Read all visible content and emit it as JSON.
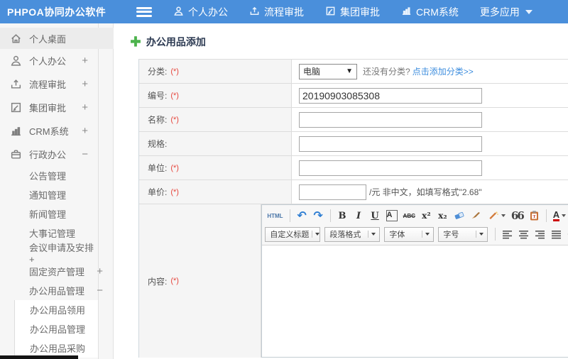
{
  "topbar": {
    "logo": "PHPOA协同办公软件",
    "nav": [
      {
        "label": "个人办公",
        "icon": "user-icon"
      },
      {
        "label": "流程审批",
        "icon": "workflow-icon"
      },
      {
        "label": "集团审批",
        "icon": "edit-square-icon"
      },
      {
        "label": "CRM系统",
        "icon": "bar-chart-icon"
      },
      {
        "label": "更多应用",
        "icon": "caret-down-icon"
      }
    ]
  },
  "sidebar": {
    "items": [
      {
        "label": "个人桌面",
        "expand": ""
      },
      {
        "label": "个人办公",
        "expand": "+"
      },
      {
        "label": "流程审批",
        "expand": "+"
      },
      {
        "label": "集团审批",
        "expand": "+"
      },
      {
        "label": "CRM系统",
        "expand": "+"
      },
      {
        "label": "行政办公",
        "expand": "−"
      },
      {
        "label": "公告管理"
      },
      {
        "label": "通知管理"
      },
      {
        "label": "新闻管理"
      },
      {
        "label": "大事记管理"
      },
      {
        "label": "会议申请及安排+"
      },
      {
        "label": "固定资产管理",
        "expand": "+"
      },
      {
        "label": "办公用品管理",
        "expand": "−"
      },
      {
        "label": "办公用品领用"
      },
      {
        "label": "办公用品管理"
      },
      {
        "label": "办公用品采购"
      }
    ]
  },
  "main": {
    "title": "办公用品添加",
    "form": {
      "star": "(*)",
      "category": {
        "label": "分类:",
        "select_value": "电脑",
        "hint": "还没有分类?",
        "link": "点击添加分类>>"
      },
      "code": {
        "label": "编号:",
        "value": "20190903085308"
      },
      "name": {
        "label": "名称:"
      },
      "spec": {
        "label": "规格:"
      },
      "unit": {
        "label": "单位:"
      },
      "price": {
        "label": "单价:",
        "suffix": "/元 非中文，如填写格式\"2.68\""
      },
      "content": {
        "label": "内容:"
      }
    },
    "editor": {
      "html": "HTML",
      "undo": "↶",
      "redo": "↷",
      "bold": "B",
      "italic": "I",
      "underline": "U",
      "fontbox": "A",
      "strike": "ABC",
      "superscript": "x²",
      "subscript": "x₂",
      "quote": "66",
      "paste_t": "T",
      "forecolor": "A",
      "backcolor": "ab",
      "combos": [
        "自定义标题",
        "段落格式",
        "字体",
        "字号"
      ]
    }
  },
  "colors": {
    "topbar_blue": "#4a8fdb",
    "link_blue": "#3e8ede",
    "required_red": "#e6453c",
    "title_navy": "#2c3a52",
    "plus_green": "#4db34d",
    "sidebar_bg": "#f6f6f6",
    "label_cell_bg": "#f5f5f5"
  }
}
